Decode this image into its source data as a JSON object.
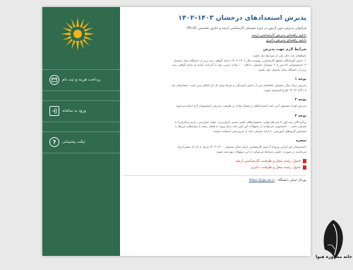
{
  "sidebar": {
    "items": [
      {
        "label": "پرداخت هزینه و ثبت نام",
        "icon": "payment-card-icon"
      },
      {
        "label": "ورود به سامانه",
        "icon": "login-icon"
      },
      {
        "label": "تیکت پشتیبانی",
        "icon": "help-icon"
      }
    ],
    "bg_color": "#2f6b4c",
    "logo_color": "#f2b21b"
  },
  "main": {
    "title": "پذیرش استعدادهای درخشان ۱۴۰۳–۱۴۰۲",
    "subtitle": "فراخوان پذیرش بدون آزمون در دوره تحصیلی کارشناسی ارشد و دکتری تخصصی (Ph.D)",
    "download_links": [
      "دانلود راهنمای پذیرش کارشناسی ارشد",
      "دانلود راهنمای پذیرش دکتری"
    ],
    "sections": [
      {
        "heading": "شرایط لازم جهت پذیرش",
        "lines": [
          "داوطلبان باید حائز یکی از شرایط ذیل باشند.",
          "۱- دانش آموختگان مقطع کارشناسی پیوسته سال ۱۴۰۲–۱۴۰۳ دارای گواهی رتبه برتر از دانشگاه محل تحصیل.",
          "۲- دانشجویانی که پس از ۶ نیمسال تحصیلی حداقل ۱۰۰ واحد درسی خود را گذرانده باشند و دارای گواهی رتبه",
          "برتر از دانشگاه محل تحصیل خود باشند."
        ]
      },
      {
        "heading": "توجه ۱",
        "lines": [
          "پذیرش برای سال تحصیلی بلافاصله پس از دانش آموختگی و صرفا برای یک بار امکان پذیر است. متقاضیان باید",
          "تا ۱۴۰۳/۰۶/۳۱ فارغ التحصیل شوند."
        ]
      },
      {
        "heading": "توجه ۲",
        "lines": [
          "پذیرش افراد مشمول آیین نامه استعدادهای درخشان مازاد بر ظرفیت پذیرش دانشجویان آزاد انجام می‌شود."
        ]
      },
      {
        "heading": "توجه ۳",
        "lines": [
          "برگزیدگان رتبه اول تا پانزدهم نهایی جشنواره‌های علمی معتبر (خوارزمی، جوان خوارزمی، رازی و فارابی) با",
          "معرفی دفتر ... دانشجویی می‌توانند از تسهیلات این آیین نامه برای ورود به همان رشته یا رشته‌های مرتبط به",
          "تشخیص گروه‌های آموزشی، با ارائه معرفی نامه از سرپرستی استفاده نمایند."
        ]
      },
      {
        "heading": "تبصره",
        "lines": [
          "دانشجویان غیر ایرانی ورودی آزمون کارشناسی ارشد سال تحصیلی ۱۴۰۰–۱۴۰۲ و بعد از آن که مقیم ایران",
          "می‌باشند در صورت داشتن شرایط می‌توانند از این تسهیلات بهره‌مند شوند."
        ]
      }
    ],
    "tables": [
      "جدول رشته محل و ظرفیت کارشناسی ارشد",
      "جدول رشته محل و ظرفیت دکتری"
    ],
    "footer": {
      "label": "پورتال اصلی دانشگاه :",
      "url": "https://pgu.ac.ir"
    }
  },
  "watermark": {
    "text": "خانه مشاوره هیوا"
  }
}
